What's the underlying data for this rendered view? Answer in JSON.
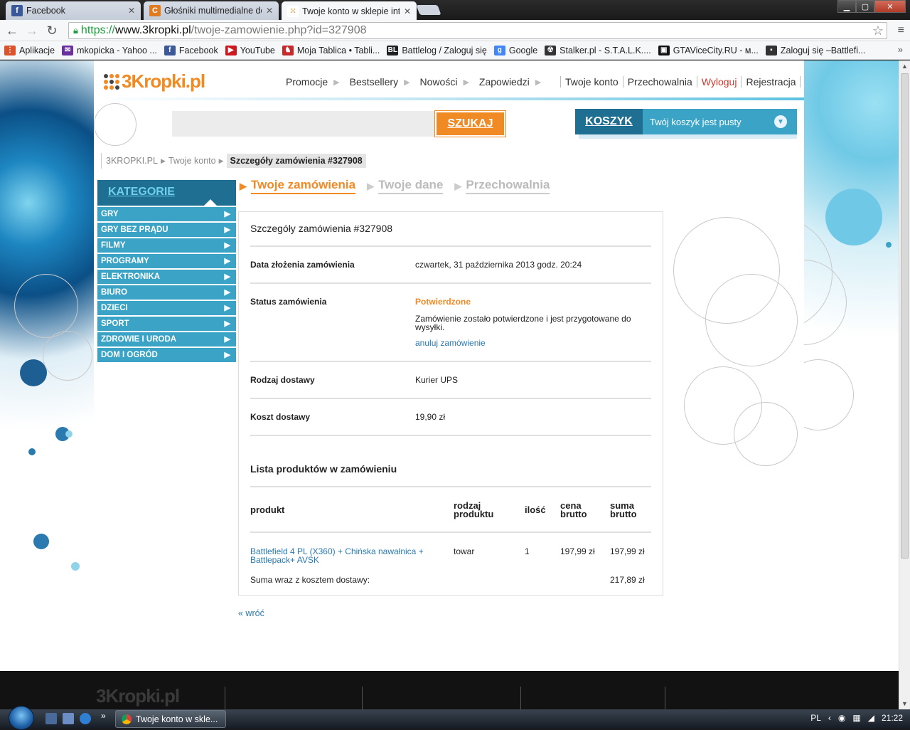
{
  "browser": {
    "tabs": [
      {
        "title": "Facebook",
        "icon": "facebook-icon",
        "color": "#3b5998",
        "glyph": "f"
      },
      {
        "title": "Głośniki multimedialne do",
        "icon": "ceneo-icon",
        "color": "#e07b22",
        "glyph": "C"
      },
      {
        "title": "Twoje konto w sklepie inte",
        "icon": "3kropki-icon",
        "color": "#f08a24",
        "glyph": "⁙"
      }
    ],
    "url": {
      "scheme": "https://",
      "host": "www.3kropki.pl",
      "path": "/twoje-zamowienie.php?id=327908"
    },
    "bookmarks": [
      {
        "label": "Aplikacje",
        "icon": "apps-icon",
        "color": "#d9532c",
        "glyph": "⋮"
      },
      {
        "label": "mkopicka - Yahoo ...",
        "icon": "yahoo-mail-icon",
        "color": "#6b2fa0",
        "glyph": "✉"
      },
      {
        "label": "Facebook",
        "icon": "facebook-icon",
        "color": "#3b5998",
        "glyph": "f"
      },
      {
        "label": "YouTube",
        "icon": "youtube-icon",
        "color": "#cc181e",
        "glyph": "▶"
      },
      {
        "label": "Moja Tablica • Tabli...",
        "icon": "tablica-icon",
        "color": "#c62a2a",
        "glyph": "♞"
      },
      {
        "label": "Battlelog / Zaloguj się",
        "icon": "battlelog-icon",
        "color": "#222222",
        "glyph": "BL"
      },
      {
        "label": "Google",
        "icon": "google-icon",
        "color": "#4285f4",
        "glyph": "g"
      },
      {
        "label": "Stalker.pl - S.T.A.L.K....",
        "icon": "stalker-icon",
        "color": "#333333",
        "glyph": "☢"
      },
      {
        "label": "GTAViceCity.RU - м...",
        "icon": "gtavc-icon",
        "color": "#111111",
        "glyph": "▣"
      },
      {
        "label": "Zaloguj się –Battlefi...",
        "icon": "battlefield-icon",
        "color": "#333333",
        "glyph": "▪"
      }
    ]
  },
  "site": {
    "logo": "3Kropki.pl",
    "topnav": [
      "Promocje",
      "Bestsellery",
      "Nowości",
      "Zapowiedzi"
    ],
    "usernav": [
      "Twoje konto",
      "Przechowalnia",
      "Wyloguj",
      "Rejestracja"
    ],
    "search_button": "SZUKAJ",
    "search_placeholder": "",
    "cart_label": "KOSZYK",
    "cart_status": "Twój koszyk jest pusty",
    "breadcrumb": [
      "3KROPKI.PL",
      "Twoje konto",
      "Szczegóły zamówienia #327908"
    ],
    "categories_title": "KATEGORIE",
    "categories": [
      "GRY",
      "GRY BEZ PRĄDU",
      "FILMY",
      "PROGRAMY",
      "ELEKTRONIKA",
      "BIURO",
      "DZIECI",
      "SPORT",
      "ZDROWIE I URODA",
      "DOM I OGRÓD"
    ],
    "subtabs": [
      "Twoje zamówienia",
      "Twoje dane",
      "Przechowalnia"
    ]
  },
  "order": {
    "title": "Szczegóły zamówienia #327908",
    "date_label": "Data złożenia zamówienia",
    "date_value": "czwartek, 31 października 2013 godz. 20:24",
    "status_label": "Status zamówienia",
    "status_value": "Potwierdzone",
    "status_desc": "Zamówienie zostało potwierdzone i jest przygotowane do wysyłki.",
    "cancel_link": "anuluj zamówienie",
    "delivery_label": "Rodzaj dostawy",
    "delivery_value": "Kurier UPS",
    "cost_label": "Koszt dostawy",
    "cost_value": "19,90 zł",
    "list_title": "Lista produktów w zamówieniu",
    "columns": {
      "product": "produkt",
      "type": "rodzaj produktu",
      "qty": "ilość",
      "price": "cena brutto",
      "sum": "suma brutto"
    },
    "items": [
      {
        "product": "Battlefield 4 PL (X360) + Chińska nawałnica + Battlepack+ AVSK",
        "type": "towar",
        "qty": "1",
        "price": "197,99 zł",
        "sum": "197,99 zł"
      }
    ],
    "total_label": "Suma wraz z kosztem dostawy:",
    "total_value": "217,89 zł",
    "back_link": "« wróć"
  },
  "footer": {
    "logo": "3Kropki.pl"
  },
  "taskbar": {
    "task_title": "Twoje konto w skle...",
    "lang": "PL",
    "clock": "21:22"
  },
  "colors": {
    "accent_orange": "#f08a24",
    "accent_teal": "#3aa3c6",
    "dark_teal": "#1f6f93",
    "link_blue": "#2a7ab0"
  }
}
